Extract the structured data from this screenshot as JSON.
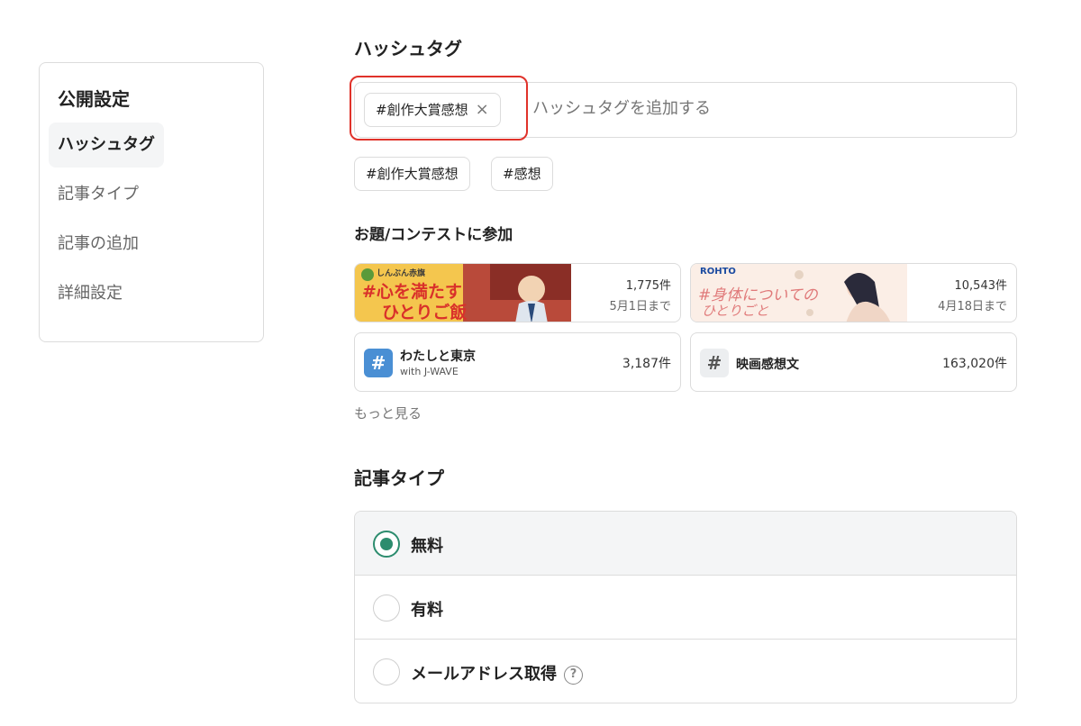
{
  "sidebar": {
    "title": "公開設定",
    "items": [
      {
        "label": "ハッシュタグ"
      },
      {
        "label": "記事タイプ"
      },
      {
        "label": "記事の追加"
      },
      {
        "label": "詳細設定"
      }
    ]
  },
  "hashtag": {
    "title": "ハッシュタグ",
    "selected_tag": "#創作大賞感想",
    "remove_icon": "×",
    "placeholder": "ハッシュタグを追加する",
    "suggestions": [
      "#創作大賞感想",
      "#感想"
    ]
  },
  "contest": {
    "title": "お題/コンテストに参加",
    "items": [
      {
        "banner_brand": "しんぶん赤旗",
        "banner_line1": "#心を満たす",
        "banner_line2": "ひとりご飯",
        "count": "1,775件",
        "deadline": "5月1日まで"
      },
      {
        "banner_brand": "ROHTO",
        "banner_line1": "#身体についての",
        "banner_line2": "ひとりごと",
        "count": "10,543件",
        "deadline": "4月18日まで"
      },
      {
        "icon": "#",
        "name": "わたしと東京",
        "sub": "with J-WAVE",
        "count": "3,187件"
      },
      {
        "icon": "#",
        "name": "映画感想文",
        "count": "163,020件"
      }
    ],
    "more": "もっと見る"
  },
  "article_type": {
    "title": "記事タイプ",
    "options": [
      {
        "label": "無料",
        "selected": true
      },
      {
        "label": "有料",
        "selected": false
      },
      {
        "label": "メールアドレス取得",
        "selected": false,
        "help_icon": "?"
      }
    ]
  },
  "colors": {
    "accent_green": "#2c8c6e",
    "highlight_red": "#e0322a",
    "hash_blue": "#4a8fd4"
  }
}
